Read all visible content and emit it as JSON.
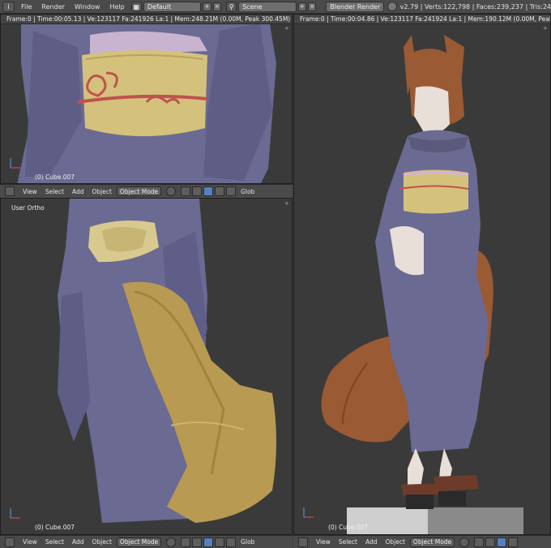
{
  "topbar": {
    "menus": [
      "File",
      "Render",
      "Window",
      "Help"
    ],
    "layout_value": "Default",
    "scene_value": "Scene",
    "engine_value": "Blender Render",
    "stats": "v2.79 | Verts:122,798 | Faces:239,237 | Tris:24"
  },
  "panes": {
    "top_left": {
      "info": "Frame:0 | Time:00:05.13 | Ve:123117 Fa:241926 La:1 | Mem:248.21M (0.00M, Peak 300.45M)",
      "object": "(0) Cube.007"
    },
    "bottom_left": {
      "view_label": "User Ortho",
      "object": "(0) Cube.007"
    },
    "right": {
      "info": "Frame:0 | Time:00:04.86 | Ve:123117 Fa:241924 La:1 | Mem:190.12M (0.00M, Peak 300.45M)",
      "object": "(0) Cube.007"
    }
  },
  "footer": {
    "view": "View",
    "select": "Select",
    "add": "Add",
    "object": "Object",
    "mode": "Object Mode",
    "global": "Glob"
  },
  "colors": {
    "kimono": "#6b6a93",
    "obi": "#d4c27c",
    "tail": "#b89a52",
    "hair": "#9a5a33",
    "cord": "#c0524f"
  }
}
